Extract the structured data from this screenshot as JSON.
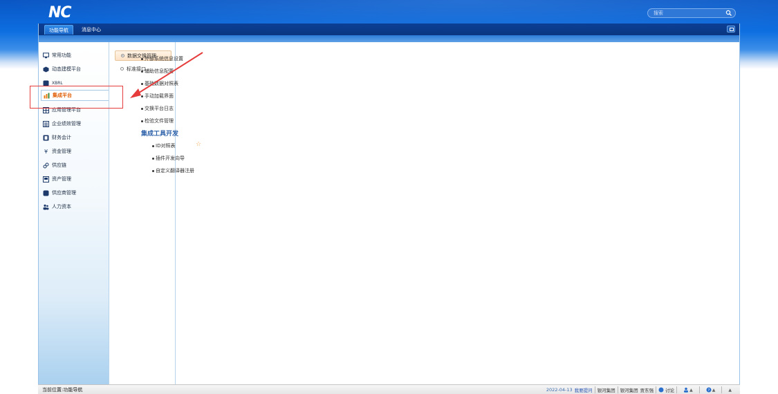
{
  "header": {
    "logo": "NC",
    "search_placeholder": "搜索"
  },
  "tabs": [
    {
      "label": "功能导航",
      "active": true
    },
    {
      "label": "消息中心",
      "active": false
    }
  ],
  "sidebar": {
    "items": [
      {
        "label": "常用功能",
        "icon": "monitor-icon"
      },
      {
        "label": "动态建模平台",
        "icon": "cube-icon"
      },
      {
        "label": "XBRL",
        "icon": "database-icon"
      },
      {
        "label": "集成平台",
        "icon": "integration-icon",
        "active": true
      },
      {
        "label": "应用管理平台",
        "icon": "grid-icon"
      },
      {
        "label": "企业绩效管理",
        "icon": "chart-box-icon"
      },
      {
        "label": "财务会计",
        "icon": "ledger-icon"
      },
      {
        "label": "资金管理",
        "icon": "yen-icon"
      },
      {
        "label": "供应链",
        "icon": "link-icon"
      },
      {
        "label": "资产管理",
        "icon": "asset-icon"
      },
      {
        "label": "供应商管理",
        "icon": "supplier-icon"
      },
      {
        "label": "人力资本",
        "icon": "people-icon"
      }
    ]
  },
  "midnav": {
    "items": [
      {
        "label": "数据交换管理",
        "active": true
      },
      {
        "label": "标准接口",
        "active": false
      }
    ]
  },
  "content": {
    "links": [
      "外部系统信息设置",
      "辅助信息配置",
      "基础数据对照表",
      "手动加载界面",
      "交换平台日志",
      "检验文件管理"
    ],
    "section_title": "集成工具开发",
    "sub_links": [
      "ID对照表",
      "插件开发向导",
      "自定义翻译器注册"
    ]
  },
  "statusbar": {
    "location": "当前位置:功能导航",
    "date": "2022-04-13",
    "feedback": "我要提问",
    "group1": "银河集团",
    "group2": "银河集团",
    "user": "贾东强",
    "discuss": "讨论"
  },
  "colors": {
    "header_blue": "#0d6ee0",
    "active_orange": "#e05a00",
    "annotation_red": "#e53b3b"
  }
}
